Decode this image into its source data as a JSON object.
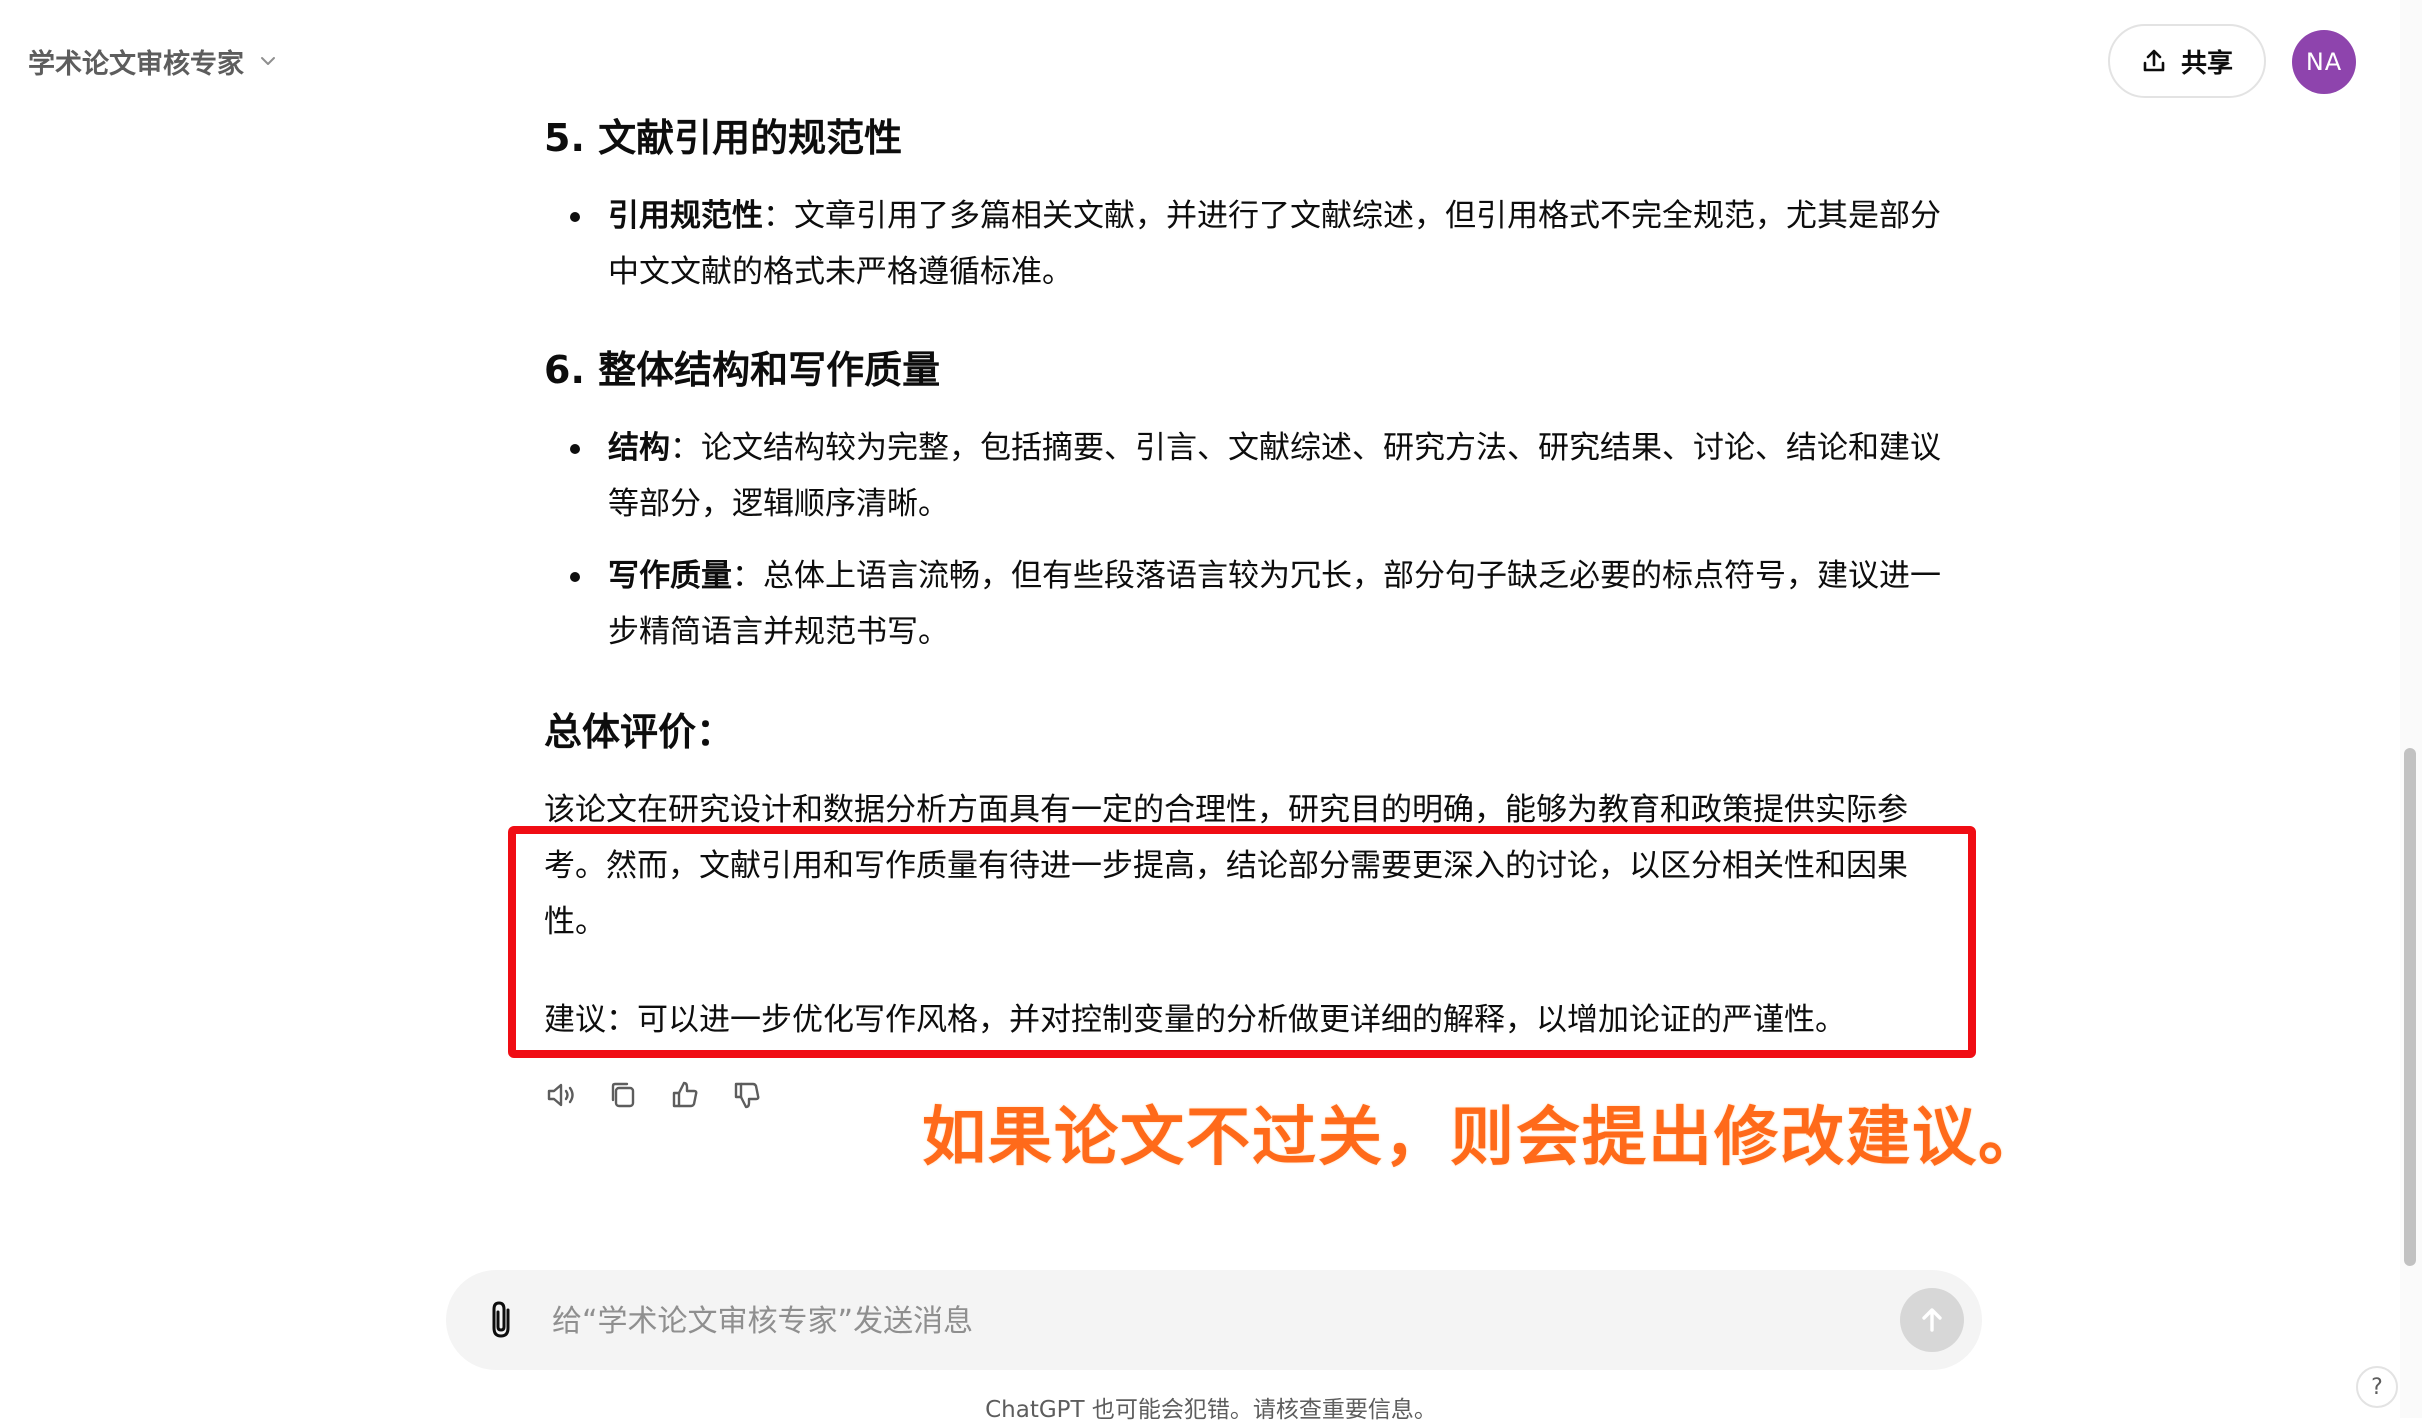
{
  "header": {
    "gpt_name": "学术论文审核专家",
    "share_label": "共享",
    "avatar_initials": "NA",
    "avatar_color": "#8e44ad"
  },
  "message": {
    "sections": [
      {
        "heading": "5. 文献引用的规范性",
        "bullets": [
          {
            "label": "引用规范性",
            "text": "：文章引用了多篇相关文献，并进行了文献综述，但引用格式不完全规范，尤其是部分中文文献的格式未严格遵循标准。"
          }
        ]
      },
      {
        "heading": "6. 整体结构和写作质量",
        "bullets": [
          {
            "label": "结构",
            "text": "：论文结构较为完整，包括摘要、引言、文献综述、研究方法、研究结果、讨论、结论和建议等部分，逻辑顺序清晰。"
          },
          {
            "label": "写作质量",
            "text": "：总体上语言流畅，但有些段落语言较为冗长，部分句子缺乏必要的标点符号，建议进一步精简语言并规范书写。"
          }
        ]
      }
    ],
    "summary_heading": "总体评价：",
    "summary_paragraph": "该论文在研究设计和数据分析方面具有一定的合理性，研究目的明确，能够为教育和政策提供实际参考。然而，文献引用和写作质量有待进一步提高，结论部分需要更深入的讨论，以区分相关性和因果性。",
    "suggestion_paragraph": "建议：可以进一步优化写作风格，并对控制变量的分析做更详细的解释，以增加论证的严谨性。"
  },
  "actions": {
    "icons": [
      "speaker-icon",
      "copy-icon",
      "thumbs-up-icon",
      "thumbs-down-icon"
    ]
  },
  "annotation": {
    "text": "如果论文不过关，则会提出修改建议。",
    "box_color": "#f00d14",
    "text_color": "#ff6a1a"
  },
  "composer": {
    "placeholder": "给“学术论文审核专家”发送消息",
    "value": ""
  },
  "footer": {
    "disclaimer": "ChatGPT 也可能会犯错。请核查重要信息。",
    "help_label": "?"
  }
}
